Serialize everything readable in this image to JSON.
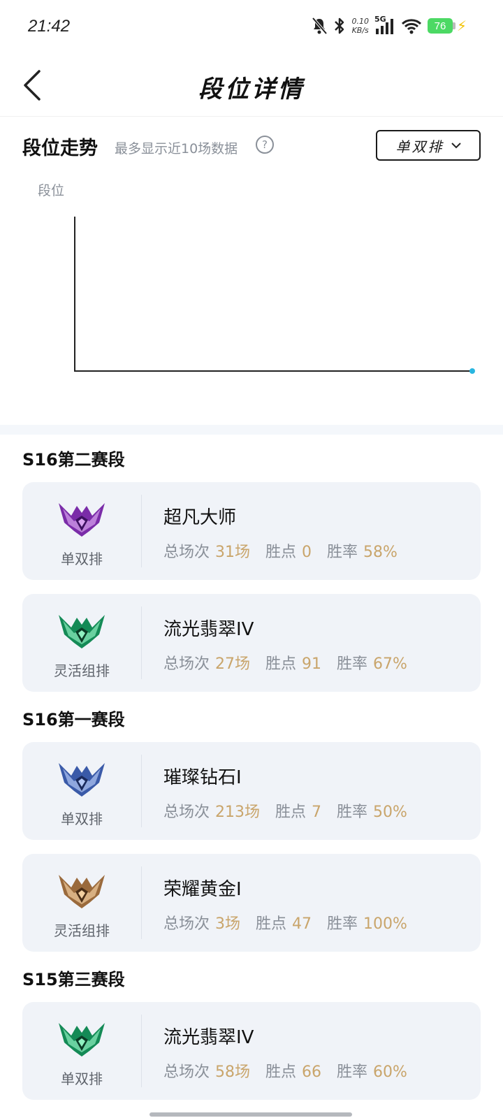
{
  "status": {
    "time": "21:42",
    "net_speed_value": "0.10",
    "net_speed_unit": "KB/s",
    "network": "5G",
    "battery": "76"
  },
  "header": {
    "title": "段位详情"
  },
  "trend": {
    "title": "段位走势",
    "subtitle": "最多显示近10场数据",
    "help_glyph": "?",
    "mode": "单双排",
    "axis_label": "段位",
    "accent_color": "#29b6e0"
  },
  "seasons": [
    {
      "name": "S16第二赛段",
      "ranks": [
        {
          "queue": "单双排",
          "rank": "超凡大师",
          "total_label": "总场次",
          "total": "31场",
          "lp_label": "胜点",
          "lp": "0",
          "wr_label": "胜率",
          "winrate": "58%",
          "emblem": "master-emblem"
        },
        {
          "queue": "灵活组排",
          "rank": "流光翡翠IV",
          "total_label": "总场次",
          "total": "27场",
          "lp_label": "胜点",
          "lp": "91",
          "wr_label": "胜率",
          "winrate": "67%",
          "emblem": "emerald-emblem"
        }
      ]
    },
    {
      "name": "S16第一赛段",
      "ranks": [
        {
          "queue": "单双排",
          "rank": "璀璨钻石I",
          "total_label": "总场次",
          "total": "213场",
          "lp_label": "胜点",
          "lp": "7",
          "wr_label": "胜率",
          "winrate": "50%",
          "emblem": "diamond-emblem"
        },
        {
          "queue": "灵活组排",
          "rank": "荣耀黄金I",
          "total_label": "总场次",
          "total": "3场",
          "lp_label": "胜点",
          "lp": "47",
          "wr_label": "胜率",
          "winrate": "100%",
          "emblem": "gold-emblem"
        }
      ]
    },
    {
      "name": "S15第三赛段",
      "ranks": [
        {
          "queue": "单双排",
          "rank": "流光翡翠IV",
          "total_label": "总场次",
          "total": "58场",
          "lp_label": "胜点",
          "lp": "66",
          "wr_label": "胜率",
          "winrate": "60%",
          "emblem": "emerald-emblem"
        }
      ]
    }
  ]
}
